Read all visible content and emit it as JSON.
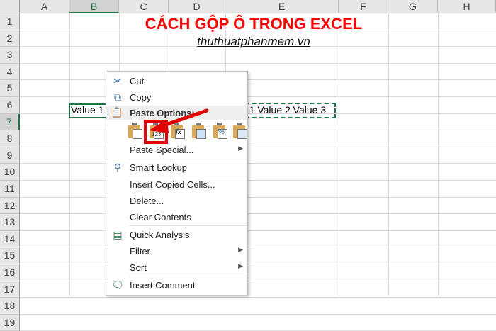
{
  "columns": [
    "A",
    "B",
    "C",
    "D",
    "E",
    "F",
    "G",
    "H"
  ],
  "rows": [
    "1",
    "2",
    "3",
    "4",
    "5",
    "6",
    "7",
    "8",
    "9",
    "10",
    "11",
    "12",
    "13",
    "14",
    "15",
    "16",
    "17",
    "18",
    "19"
  ],
  "title": "CÁCH GỘP Ô TRONG EXCEL",
  "subtitle": "thuthuatphanmem.vn",
  "cells": {
    "b7": "Value 1",
    "e7_partial": "e 1 Value 2 Value 3"
  },
  "menu": {
    "cut": "Cut",
    "copy": "Copy",
    "paste_options": "Paste Options:",
    "paste_123": "123",
    "paste_fx": "fx",
    "paste_special": "Paste Special...",
    "smart_lookup": "Smart Lookup",
    "insert_copied": "Insert Copied Cells...",
    "delete": "Delete...",
    "clear_contents": "Clear Contents",
    "quick_analysis": "Quick Analysis",
    "filter": "Filter",
    "sort": "Sort",
    "insert_comment": "Insert Comment"
  },
  "icons": {
    "cut": "scissors-icon",
    "copy": "copy-icon",
    "paste": "clipboard-icon",
    "smart_lookup": "search-icon",
    "quick_analysis": "quick-analysis-icon",
    "insert_comment": "comment-icon",
    "submenu": "chevron-right-icon"
  },
  "colors": {
    "title": "#ff0000",
    "accent": "#217346",
    "highlight": "#e00000"
  }
}
